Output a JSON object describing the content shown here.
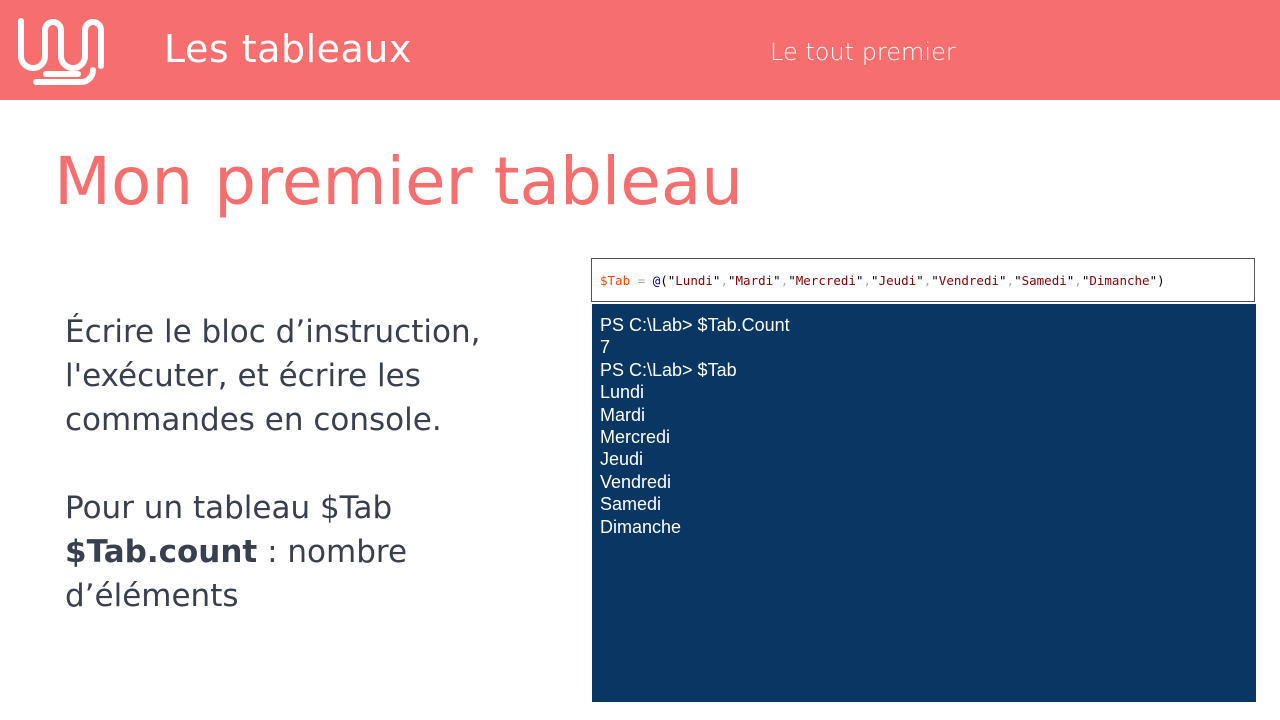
{
  "header": {
    "logo_icon": "wave-logo-icon",
    "title": "Les tableaux",
    "subtitle": "Le tout premier",
    "background_color": "#f76e6e"
  },
  "main": {
    "title": "Mon premier tableau",
    "paragraph1": "Écrire le bloc d’instruction, l'exécuter, et écrire les commandes en console.",
    "paragraph2_line1": "Pour un tableau $Tab",
    "paragraph2_bold": "$Tab.count",
    "paragraph2_rest": " : nombre d’éléments"
  },
  "code": {
    "variable": "$Tab",
    "operator": " = ",
    "at": "@",
    "open_paren": "(",
    "close_paren": ")",
    "items": [
      "Lundi",
      "Mardi",
      "Mercredi",
      "Jeudi",
      "Vendredi",
      "Samedi",
      "Dimanche"
    ]
  },
  "console": {
    "background_color": "#0a3664",
    "lines": [
      "PS C:\\Lab> $Tab.Count",
      "7",
      "PS C:\\Lab> $Tab",
      "Lundi",
      "Mardi",
      "Mercredi",
      "Jeudi",
      "Vendredi",
      "Samedi",
      "Dimanche"
    ]
  }
}
